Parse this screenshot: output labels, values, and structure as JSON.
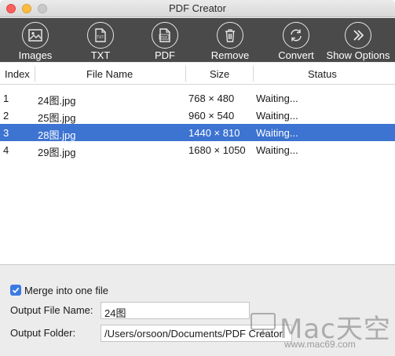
{
  "window": {
    "title": "PDF Creator"
  },
  "toolbar": {
    "buttons": [
      {
        "label": "Images",
        "icon": "image-icon"
      },
      {
        "label": "TXT",
        "icon": "txt-file-icon"
      },
      {
        "label": "PDF",
        "icon": "pdf-file-icon"
      },
      {
        "label": "Remove",
        "icon": "trash-icon"
      },
      {
        "label": "Convert",
        "icon": "convert-icon"
      },
      {
        "label": "Show Options",
        "icon": "double-chevron-icon"
      }
    ]
  },
  "table": {
    "columns": [
      "Index",
      "File Name",
      "Size",
      "Status"
    ],
    "rows": [
      {
        "index": "1",
        "name": "24图.jpg",
        "size": "768 × 480",
        "status": "Waiting...",
        "selected": false
      },
      {
        "index": "2",
        "name": "25图.jpg",
        "size": "960 × 540",
        "status": "Waiting...",
        "selected": false
      },
      {
        "index": "3",
        "name": "28图.jpg",
        "size": "1440 × 810",
        "status": "Waiting...",
        "selected": true
      },
      {
        "index": "4",
        "name": "29图.jpg",
        "size": "1680 × 1050",
        "status": "Waiting...",
        "selected": false
      }
    ]
  },
  "options": {
    "merge_label": "Merge into one file",
    "merge_checked": true,
    "output_name_label": "Output File Name:",
    "output_name_value": "24图",
    "output_folder_label": "Output Folder:",
    "output_folder_value": "/Users/orsoon/Documents/PDF Creator"
  },
  "watermark": {
    "brand": "Mac天空",
    "url": "www.mac69.com"
  },
  "colors": {
    "toolbar_bg": "#4a4a4a",
    "selection": "#3d73d1",
    "checkbox": "#3b7ae3"
  }
}
